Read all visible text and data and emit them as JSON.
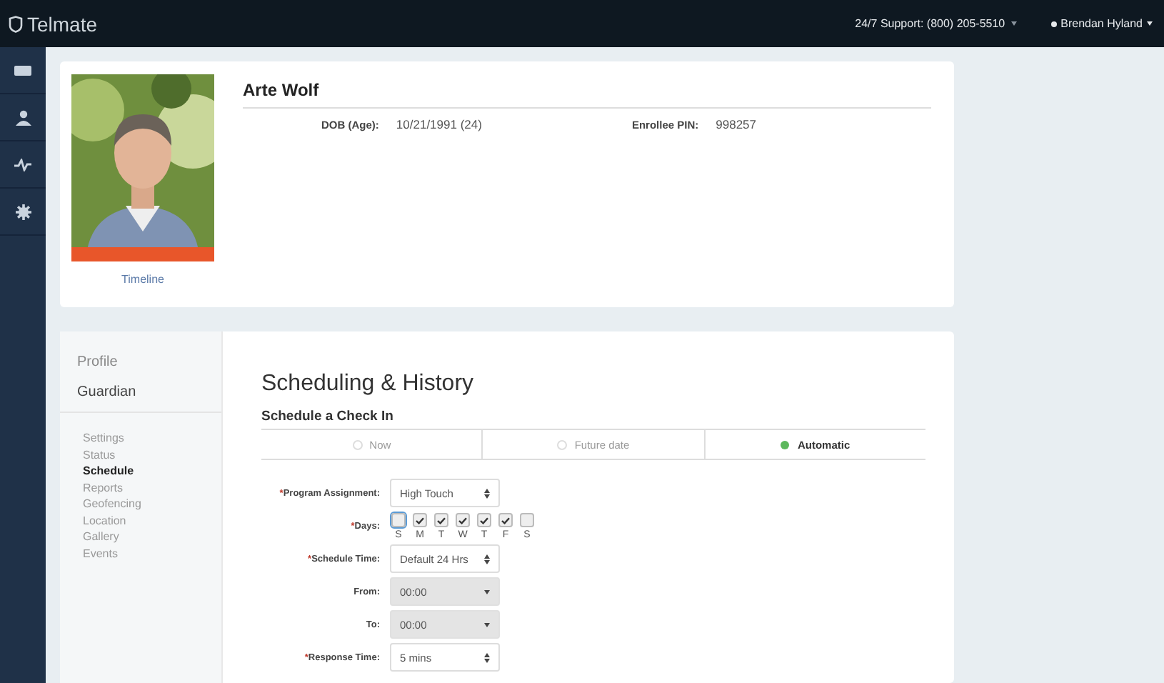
{
  "header": {
    "brand": "Telmate",
    "support": "24/7 Support: (800) 205-5510",
    "user": "Brendan Hyland"
  },
  "rail": {
    "items": [
      {
        "kind": "card",
        "selected": false
      },
      {
        "kind": "person",
        "selected": false
      },
      {
        "kind": "pulse",
        "selected": false
      },
      {
        "kind": "gear",
        "selected": false
      }
    ]
  },
  "profile": {
    "timeline_link": "Timeline",
    "name": "Arte Wolf",
    "fields": [
      {
        "label": "DOB (Age):",
        "value": "10/21/1991 (24)"
      },
      {
        "label": "Enrollee PIN:",
        "value": "998257"
      }
    ]
  },
  "menu": {
    "sections": [
      {
        "label": "Profile",
        "selected": false
      },
      {
        "label": "Guardian",
        "selected": false
      }
    ],
    "items": [
      {
        "label": "Settings",
        "selected": false
      },
      {
        "label": "Status",
        "selected": false
      },
      {
        "label": "Schedule",
        "selected": true
      },
      {
        "label": "Reports",
        "selected": false
      },
      {
        "label": "Geofencing",
        "selected": false
      },
      {
        "label": "Location",
        "selected": false
      },
      {
        "label": "Gallery",
        "selected": false
      },
      {
        "label": "Events",
        "selected": false
      }
    ]
  },
  "schedule": {
    "title": "Scheduling & History",
    "subtitle": "Schedule a Check In",
    "modes": [
      {
        "label": "Now",
        "selected": false
      },
      {
        "label": "Future date",
        "selected": false
      },
      {
        "label": "Automatic",
        "selected": true
      }
    ],
    "rows": [
      {
        "kind": "select",
        "required_mark": "*",
        "label": "Program Assignment:",
        "value": "High Touch",
        "disabled": false
      },
      {
        "kind": "days",
        "required_mark": "*",
        "label": "Days:",
        "days": [
          {
            "letter": "S",
            "checked": false,
            "focused": true
          },
          {
            "letter": "M",
            "checked": true,
            "focused": false
          },
          {
            "letter": "T",
            "checked": true,
            "focused": false
          },
          {
            "letter": "W",
            "checked": true,
            "focused": false
          },
          {
            "letter": "T",
            "checked": true,
            "focused": false
          },
          {
            "letter": "F",
            "checked": true,
            "focused": false
          },
          {
            "letter": "S",
            "checked": false,
            "focused": false
          }
        ]
      },
      {
        "kind": "select",
        "required_mark": "*",
        "label": "Schedule Time:",
        "value": "Default 24 Hrs",
        "disabled": false
      },
      {
        "kind": "select",
        "label": "From:",
        "value": "00:00",
        "disabled": true
      },
      {
        "kind": "select",
        "label": "To:",
        "value": "00:00",
        "disabled": true
      },
      {
        "kind": "select",
        "required_mark": "*",
        "label": "Response Time:",
        "value": "5 mins",
        "disabled": false
      }
    ]
  }
}
